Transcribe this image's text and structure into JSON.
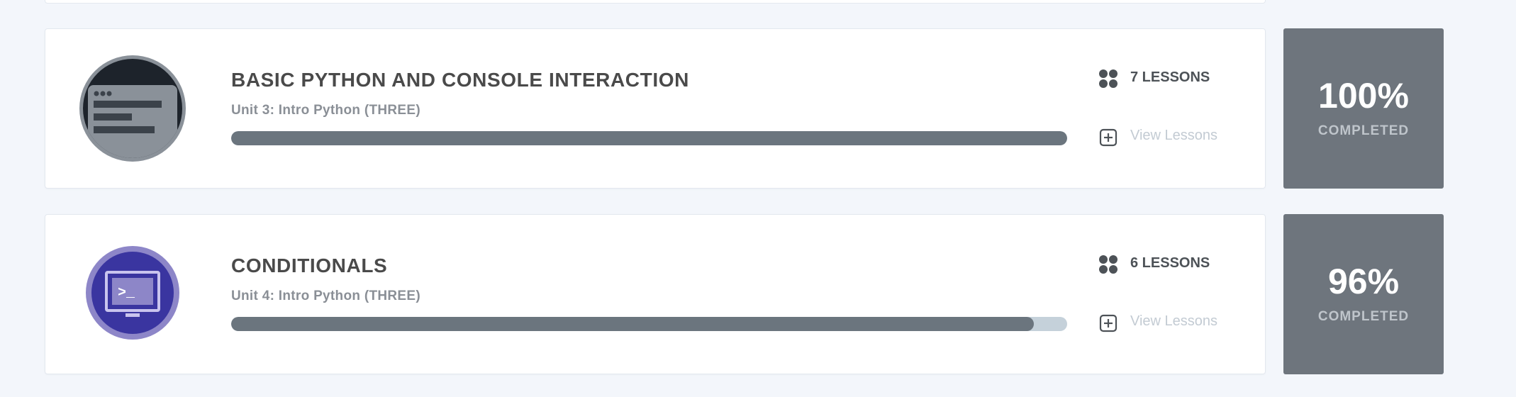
{
  "units": [
    {
      "icon": "browser-window-icon",
      "title": "BASIC PYTHON AND CONSOLE INTERACTION",
      "subtitle": "Unit 3: Intro Python (THREE)",
      "progress": 1.0,
      "lessons_label": "7 LESSONS",
      "view_label": "View Lessons",
      "percent": "100%",
      "completed_label": "COMPLETED"
    },
    {
      "icon": "terminal-monitor-icon",
      "title": "CONDITIONALS",
      "subtitle": "Unit 4: Intro Python (THREE)",
      "progress": 0.96,
      "lessons_label": "6 LESSONS",
      "view_label": "View Lessons",
      "percent": "96%",
      "completed_label": "COMPLETED"
    }
  ],
  "colors": {
    "page_bg": "#f3f6fb",
    "progress_fill": "#6b757e",
    "progress_track": "#c5d1da",
    "percent_box": "#6e757d",
    "unit4_icon_bg": "#3a35a0"
  }
}
